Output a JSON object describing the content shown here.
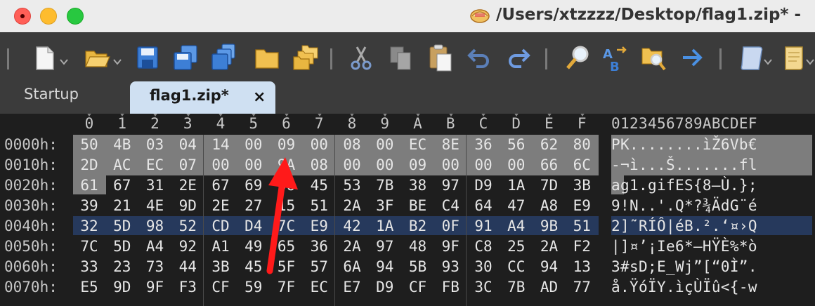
{
  "window": {
    "title": "/Users/xtzzzz/Desktop/flag1.zip* -"
  },
  "toolbar": {
    "buttons": [
      "new-file",
      "open-folder",
      "save",
      "save-as",
      "save-all",
      "folder",
      "folder-stack",
      "cut",
      "copy",
      "paste",
      "undo",
      "redo",
      "find",
      "find-replace",
      "find-in-files",
      "goto",
      "script",
      "scroll"
    ]
  },
  "tabs": [
    {
      "label": "Startup",
      "active": false
    },
    {
      "label": "flag1.zip*",
      "active": true,
      "close": "×"
    }
  ],
  "hex": {
    "columns": [
      "0",
      "1",
      "2",
      "3",
      "4",
      "5",
      "6",
      "7",
      "8",
      "9",
      "A",
      "B",
      "C",
      "D",
      "E",
      "F"
    ],
    "ascii_header": "0123456789ABCDEF",
    "rows": [
      {
        "offset": "0000h:",
        "bytes": [
          "50",
          "4B",
          "03",
          "04",
          "14",
          "00",
          "09",
          "00",
          "08",
          "00",
          "EC",
          "8E",
          "36",
          "56",
          "62",
          "80"
        ],
        "ascii": "PK........ìŽ6Vb€"
      },
      {
        "offset": "0010h:",
        "bytes": [
          "2D",
          "AC",
          "EC",
          "07",
          "00",
          "00",
          "9A",
          "08",
          "00",
          "00",
          "09",
          "00",
          "00",
          "00",
          "66",
          "6C"
        ],
        "ascii": "-¬ì...Š.......fl"
      },
      {
        "offset": "0020h:",
        "bytes": [
          "61",
          "67",
          "31",
          "2E",
          "67",
          "69",
          "66",
          "45",
          "53",
          "7B",
          "38",
          "97",
          "D9",
          "1A",
          "7D",
          "3B"
        ],
        "ascii": "ag1.gifES{8—Ù.};"
      },
      {
        "offset": "0030h:",
        "bytes": [
          "39",
          "21",
          "4E",
          "9D",
          "2E",
          "27",
          "15",
          "51",
          "2A",
          "3F",
          "BE",
          "C4",
          "64",
          "47",
          "A8",
          "E9"
        ],
        "ascii": "9!N..'.Q*?¾ÄdG¨é"
      },
      {
        "offset": "0040h:",
        "bytes": [
          "32",
          "5D",
          "98",
          "52",
          "CD",
          "D4",
          "7C",
          "E9",
          "42",
          "1A",
          "B2",
          "0F",
          "91",
          "A4",
          "9B",
          "51"
        ],
        "ascii": "2]˜RÍÔ|éB.².‘¤›Q"
      },
      {
        "offset": "0050h:",
        "bytes": [
          "7C",
          "5D",
          "A4",
          "92",
          "A1",
          "49",
          "65",
          "36",
          "2A",
          "97",
          "48",
          "9F",
          "C8",
          "25",
          "2A",
          "F2"
        ],
        "ascii": "|]¤’¡Ie6*—HŸÈ%*ò"
      },
      {
        "offset": "0060h:",
        "bytes": [
          "33",
          "23",
          "73",
          "44",
          "3B",
          "45",
          "5F",
          "57",
          "6A",
          "94",
          "5B",
          "93",
          "30",
          "CC",
          "94",
          "13"
        ],
        "ascii": "3#sD;E_Wj”[“0Ì”."
      },
      {
        "offset": "0070h:",
        "bytes": [
          "E5",
          "9D",
          "9F",
          "F3",
          "CF",
          "59",
          "7F",
          "EC",
          "E7",
          "D9",
          "CF",
          "FB",
          "3C",
          "7B",
          "AD",
          "77"
        ],
        "ascii": "å.ŸóÏY.ìçÙÏû<{-w"
      }
    ],
    "selected_row_index": 4,
    "selection_bytes": 33
  },
  "colors": {
    "selection": "#7d7d7d",
    "row_highlight": "#26395c",
    "tab_active": "#cfe0f2",
    "arrow": "#ff1a1a"
  }
}
